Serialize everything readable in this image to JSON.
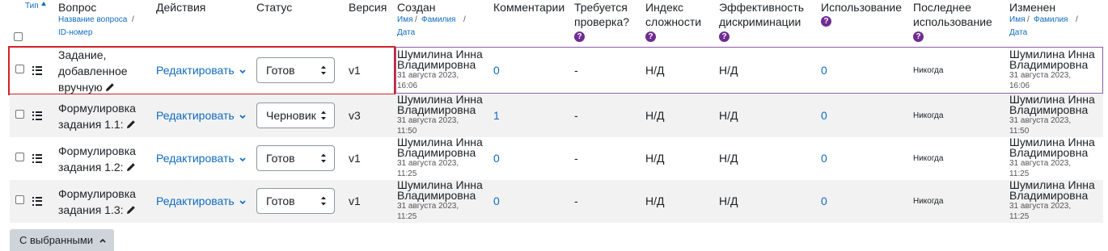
{
  "columns": {
    "type": "Тип",
    "question": "Вопрос",
    "question_sub_a": "Название вопроса",
    "question_sub_b": "ID-номер",
    "actions": "Действия",
    "status": "Статус",
    "version": "Версия",
    "created": "Создан",
    "name_sub_a": "Имя",
    "name_sub_b": "Фамилия",
    "date_sub": "Дата",
    "comments": "Комментарии",
    "needs_review_1": "Требуется",
    "needs_review_2": "проверка?",
    "facility_1": "Индекс",
    "facility_2": "сложности",
    "discrimination_1": "Эффективность",
    "discrimination_2": "дискриминации",
    "usage": "Использование",
    "last_used_1": "Последнее",
    "last_used_2": "использование",
    "modified": "Изменен",
    "separator": "/"
  },
  "rows": [
    {
      "name_lines": [
        "Задание,",
        "добавленное",
        "вручную"
      ],
      "edit_label": "Редактировать",
      "status": "Готов",
      "version": "v1",
      "author_1": "Шумилина Инна",
      "author_2": "Владимировна",
      "date_1": "31 августа 2023,",
      "date_2": "16:06",
      "comments": "0",
      "needs_review": "-",
      "facility": "Н/Д",
      "discrimination": "Н/Д",
      "usage": "0",
      "last_used": "Никогда",
      "mod_author_1": "Шумилина Инна",
      "mod_author_2": "Владимировна",
      "mod_date_1": "31 августа 2023,",
      "mod_date_2": "16:06"
    },
    {
      "name_lines": [
        "Формулировка",
        "задания 1.1:"
      ],
      "edit_label": "Редактировать",
      "status": "Черновик",
      "version": "v3",
      "author_1": "Шумилина Инна",
      "author_2": "Владимировна",
      "date_1": "31 августа 2023,",
      "date_2": "11:50",
      "comments": "1",
      "needs_review": "-",
      "facility": "Н/Д",
      "discrimination": "Н/Д",
      "usage": "0",
      "last_used": "Никогда",
      "mod_author_1": "Шумилина Инна",
      "mod_author_2": "Владимировна",
      "mod_date_1": "31 августа 2023,",
      "mod_date_2": "11:50"
    },
    {
      "name_lines": [
        "Формулировка",
        "задания 1.2:"
      ],
      "edit_label": "Редактировать",
      "status": "Готов",
      "version": "v1",
      "author_1": "Шумилина Инна",
      "author_2": "Владимировна",
      "date_1": "31 августа 2023,",
      "date_2": "11:25",
      "comments": "0",
      "needs_review": "-",
      "facility": "Н/Д",
      "discrimination": "Н/Д",
      "usage": "0",
      "last_used": "Никогда",
      "mod_author_1": "Шумилина Инна",
      "mod_author_2": "Владимировна",
      "mod_date_1": "31 августа 2023,",
      "mod_date_2": "11:25"
    },
    {
      "name_lines": [
        "Формулировка",
        "задания 1.3:"
      ],
      "edit_label": "Редактировать",
      "status": "Готов",
      "version": "v1",
      "author_1": "Шумилина Инна",
      "author_2": "Владимировна",
      "date_1": "31 августа 2023,",
      "date_2": "11:25",
      "comments": "0",
      "needs_review": "-",
      "facility": "Н/Д",
      "discrimination": "Н/Д",
      "usage": "0",
      "last_used": "Никогда",
      "mod_author_1": "Шумилина Инна",
      "mod_author_2": "Владимировна",
      "mod_date_1": "31 августа 2023,",
      "mod_date_2": "11:25"
    }
  ],
  "bulk_button": "С выбранными",
  "icons": {
    "sort": "sort-asc-icon",
    "help": "help-icon",
    "row_type": "multichoice-list-icon",
    "edit": "pencil-icon",
    "dropdown": "chevron-down-icon",
    "bulk": "chevron-up-icon"
  },
  "colors": {
    "link": "#0f6cbf",
    "highlight_border": "#d0222a",
    "help": "#6f2c91",
    "row_alt": "#f2f2f2",
    "button": "#ced4da"
  }
}
